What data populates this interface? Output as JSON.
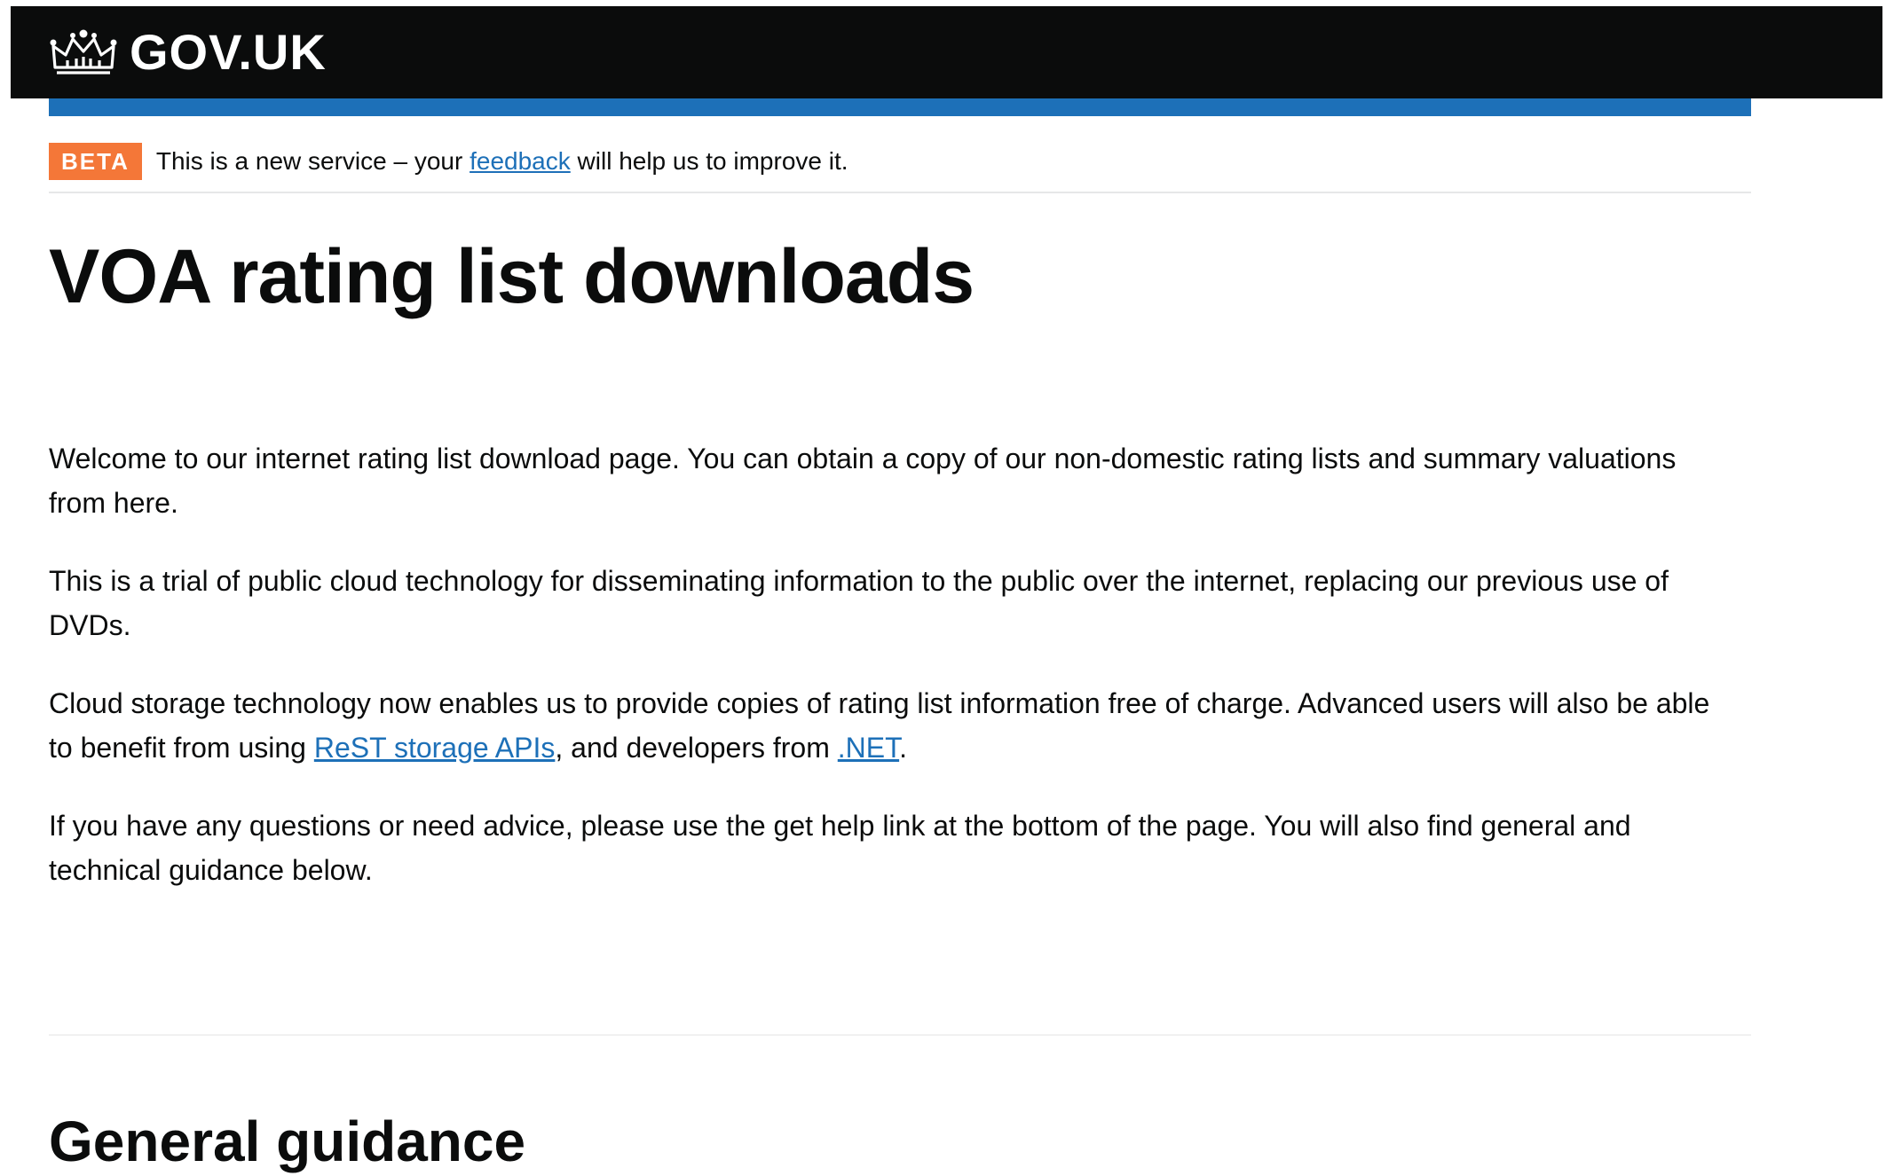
{
  "header": {
    "logo_text": "GOV.UK",
    "logo_icon": "crown-icon"
  },
  "phase_banner": {
    "tag": "BETA",
    "text_before": "This is a new service – your ",
    "link_text": "feedback",
    "text_after": " will help us to improve it."
  },
  "main": {
    "title": "VOA rating list downloads",
    "paragraphs": {
      "p1": "Welcome to our internet rating list download page. You can obtain a copy of our non-domestic rating lists and summary valuations from here.",
      "p2": "This is a trial of public cloud technology for disseminating information to the public over the internet, replacing our previous use of DVDs.",
      "p3_before": "Cloud storage technology now enables us to provide copies of rating list information free of charge. Advanced users will also be able to benefit from using ",
      "p3_link1": "ReST storage APIs",
      "p3_middle": ", and developers from ",
      "p3_link2": ".NET",
      "p3_after": ".",
      "p4": "If you have any questions or need advice, please use the get help link at the bottom of the page. You will also find general and technical guidance below."
    },
    "section_heading": "General guidance"
  },
  "colors": {
    "header_bg": "#0b0c0c",
    "brand_blue": "#1d70b8",
    "beta_tag": "#f47738",
    "link": "#1d70b8",
    "text": "#0b0c0c"
  }
}
